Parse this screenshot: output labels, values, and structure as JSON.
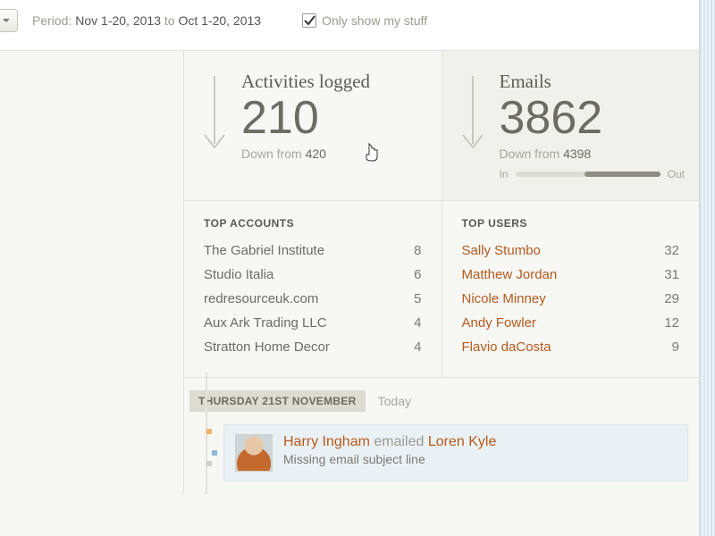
{
  "topbar": {
    "period_label": "Period:",
    "period_from": "Nov 1-20, 2013",
    "period_to_word": "to",
    "period_to": "Oct 1-20, 2013",
    "only_my_stuff": "Only show my stuff"
  },
  "cards": {
    "activities": {
      "title": "Activities logged",
      "value": "210",
      "sub_prefix": "Down from ",
      "sub_value": "420"
    },
    "emails": {
      "title": "Emails",
      "value": "3862",
      "sub_prefix": "Down from ",
      "sub_value": "4398",
      "in_label": "In",
      "out_label": "Out"
    }
  },
  "top_accounts": {
    "title": "TOP ACCOUNTS",
    "rows": [
      {
        "name": "The Gabriel Institute",
        "count": "8"
      },
      {
        "name": "Studio Italia",
        "count": "6"
      },
      {
        "name": "redresourceuk.com",
        "count": "5"
      },
      {
        "name": "Aux Ark Trading LLC",
        "count": "4"
      },
      {
        "name": "Stratton Home Decor",
        "count": "4"
      }
    ]
  },
  "top_users": {
    "title": "TOP USERS",
    "rows": [
      {
        "name": "Sally Stumbo",
        "count": "32"
      },
      {
        "name": "Matthew Jordan",
        "count": "31"
      },
      {
        "name": "Nicole Minney",
        "count": "29"
      },
      {
        "name": "Andy Fowler",
        "count": "12"
      },
      {
        "name": "Flavio daCosta",
        "count": "9"
      }
    ]
  },
  "timeline": {
    "date_label": "THURSDAY 21ST NOVEMBER",
    "today": "Today",
    "event": {
      "actor": "Harry Ingham",
      "verb": " emailed ",
      "target": "Loren Kyle",
      "subject": "Missing email subject line"
    }
  }
}
